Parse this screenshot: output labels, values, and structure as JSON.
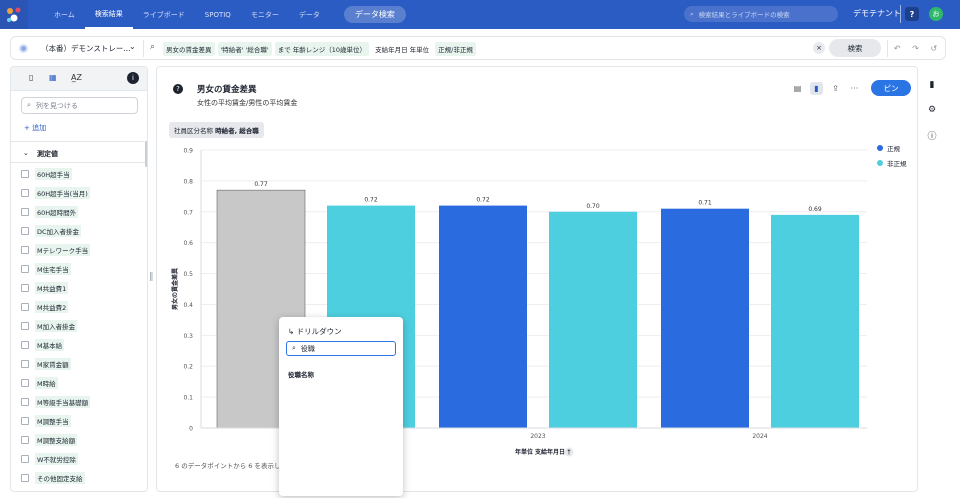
{
  "nav": {
    "tabs": [
      "ホーム",
      "検索結果",
      "ライブボード",
      "SPOTIQ",
      "モニター",
      "データ"
    ],
    "active_tab": 1,
    "data_search_button": "データ検索",
    "global_search_placeholder": "検索結果とライブボードの検索",
    "tenant": "デモテナント",
    "help": "?",
    "avatar_initial": "お"
  },
  "search": {
    "datasource": "（本番）デモンストレー...",
    "tokens": [
      {
        "text": "男女の賃金差異",
        "highlight": true
      },
      {
        "text": "'特給者' '総合職'",
        "highlight": true
      },
      {
        "text": "まで 年齢レンジ（10歳単位）",
        "highlight": true
      },
      {
        "text": "支給年月日 年単位",
        "highlight": false
      },
      {
        "text": "正規/非正規",
        "highlight": true
      }
    ],
    "search_button": "検索"
  },
  "left_panel": {
    "search_placeholder": "列を見つける",
    "add_label": "追加",
    "section_title": "測定値",
    "items": [
      "60H超手当",
      "60H超手当(当月)",
      "60H超時間外",
      "DC加入者掛金",
      "Mテレワーク手当",
      "M住宅手当",
      "M共益費1",
      "M共益費2",
      "M加入者掛金",
      "M基本給",
      "M家賃金額",
      "M時給",
      "M等級手当基礎額",
      "M調整手当",
      "M調整支給額",
      "W不就労控除",
      "その他固定支給"
    ]
  },
  "answer": {
    "title": "男女の賃金差異",
    "subtitle": "女性の平均賃金/男性の平均賃金",
    "pin_button": "ピン",
    "filter_label": "社員区分名称",
    "filter_value": "時給者, 総合職",
    "footnote": "6 のデータポイントから 6 を表示し",
    "menu_dots": "···"
  },
  "chart_data": {
    "type": "bar",
    "ylabel": "男女の賃金差異",
    "xlabel": "年単位 支給年月日",
    "sort_indicator": "↑",
    "ylim": [
      0,
      0.9
    ],
    "yticks": [
      "0",
      "0.1",
      "0.2",
      "0.3",
      "0.4",
      "0.5",
      "0.6",
      "0.7",
      "0.8",
      "0.9"
    ],
    "groups": [
      "",
      "2023",
      "2024"
    ],
    "series": [
      {
        "name": "正規",
        "values": [
          0.77,
          0.72,
          0.71
        ],
        "color": "#2b6be0"
      },
      {
        "name": "非正規",
        "values": [
          0.72,
          0.7,
          0.69
        ],
        "color": "#4ecfdf"
      }
    ],
    "data_labels": [
      "0.77",
      "0.72",
      "0.72",
      "0.70",
      "0.71",
      "0.69"
    ],
    "selected_color": "#c8c8c8"
  },
  "drill": {
    "title": "ドリルダウン",
    "input_value": "役職",
    "result": "役職名称"
  }
}
